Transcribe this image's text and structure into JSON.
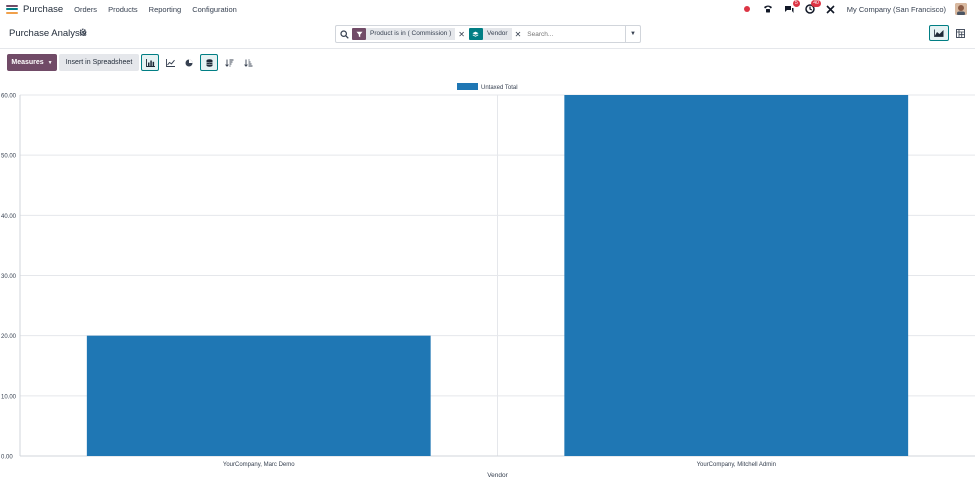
{
  "app": {
    "name": "Purchase",
    "brand_colors": [
      "#714b67",
      "#017e84",
      "#f0a04b"
    ],
    "menu": [
      "Orders",
      "Products",
      "Reporting",
      "Configuration"
    ]
  },
  "systray": {
    "recording_icon_color": "#dc3545",
    "phone_icon": "phone-icon",
    "chat_icon": "chat-icon",
    "chat_badge": "5",
    "activity_icon": "clock-icon",
    "activity_badge": "40",
    "tools_icon": "tools-icon",
    "company": "My Company (San Francisco)"
  },
  "control_panel": {
    "title": "Purchase Analysis",
    "search": {
      "facets": [
        {
          "type": "filter",
          "icon": "filter-icon",
          "color": "#714b67",
          "text": "Product is in ( Commission )"
        },
        {
          "type": "groupby",
          "icon": "layers-icon",
          "color": "#017e84",
          "text": "Vendor"
        }
      ],
      "placeholder": "Search..."
    },
    "views": [
      "graph",
      "pivot"
    ],
    "active_view": "graph"
  },
  "toolbar": {
    "measures_label": "Measures",
    "insert_label": "Insert in Spreadsheet",
    "chart_modes": [
      "bar",
      "line",
      "pie"
    ],
    "active_mode": "bar"
  },
  "chart_data": {
    "type": "bar",
    "categories": [
      "YourCompany, Marc Demo",
      "YourCompany, Mitchell Admin"
    ],
    "series": [
      {
        "name": "Untaxed Total",
        "values": [
          20.0,
          60.0
        ],
        "color": "#1f77b4"
      }
    ],
    "xlabel": "Vendor",
    "ylabel": "",
    "ylim": [
      0,
      60
    ],
    "yticks": [
      "0.00",
      "10.00",
      "20.00",
      "30.00",
      "40.00",
      "50.00",
      "60.00"
    ],
    "grid": true,
    "legend": "top-center"
  }
}
